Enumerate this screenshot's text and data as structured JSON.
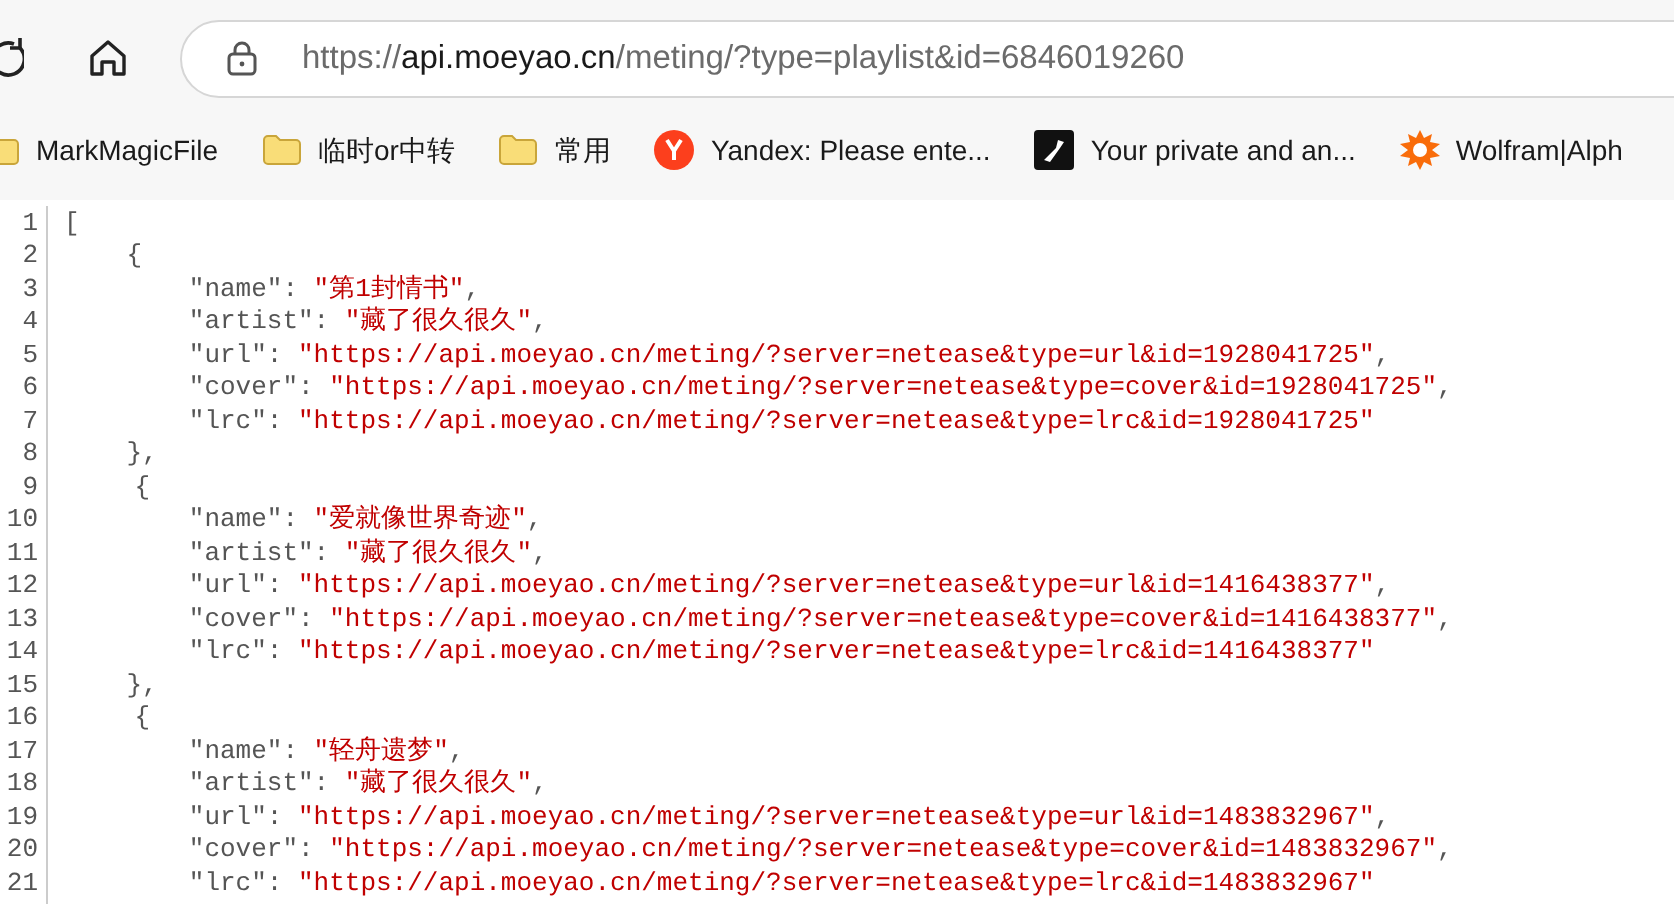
{
  "address_bar": {
    "scheme": "https://",
    "host": "api.moeyao.cn",
    "path": "/meting/?type=playlist&id=6846019260"
  },
  "bookmarks": [
    {
      "kind": "folder",
      "label": "MarkMagicFile"
    },
    {
      "kind": "folder",
      "label": "临时or中转"
    },
    {
      "kind": "folder",
      "label": "常用"
    },
    {
      "kind": "yandex",
      "label": "Yandex: Please ente..."
    },
    {
      "kind": "dark",
      "label": "Your private and an..."
    },
    {
      "kind": "wolfram",
      "label": "Wolfram|Alph"
    }
  ],
  "line_numbers": [
    "1",
    "2",
    "3",
    "4",
    "5",
    "6",
    "7",
    "8",
    "9",
    "10",
    "11",
    "12",
    "13",
    "14",
    "15",
    "16",
    "17",
    "18",
    "19",
    "20",
    "21"
  ],
  "document": {
    "open": "[",
    "objects": [
      {
        "open": "{",
        "close": "},",
        "props": [
          {
            "key": "\"name\":",
            "value": "\"第1封情书\"",
            "comma": ","
          },
          {
            "key": "\"artist\":",
            "value": "\"藏了很久很久\"",
            "comma": ","
          },
          {
            "key": "\"url\":",
            "value": "\"https://api.moeyao.cn/meting/?server=netease&type=url&id=1928041725\"",
            "comma": ","
          },
          {
            "key": "\"cover\":",
            "value": "\"https://api.moeyao.cn/meting/?server=netease&type=cover&id=1928041725\"",
            "comma": ","
          },
          {
            "key": "\"lrc\":",
            "value": "\"https://api.moeyao.cn/meting/?server=netease&type=lrc&id=1928041725\""
          }
        ]
      },
      {
        "open": "{",
        "close": "},",
        "props": [
          {
            "key": "\"name\":",
            "value": "\"爱就像世界奇迹\"",
            "comma": ","
          },
          {
            "key": "\"artist\":",
            "value": "\"藏了很久很久\"",
            "comma": ","
          },
          {
            "key": "\"url\":",
            "value": "\"https://api.moeyao.cn/meting/?server=netease&type=url&id=1416438377\"",
            "comma": ","
          },
          {
            "key": "\"cover\":",
            "value": "\"https://api.moeyao.cn/meting/?server=netease&type=cover&id=1416438377\"",
            "comma": ","
          },
          {
            "key": "\"lrc\":",
            "value": "\"https://api.moeyao.cn/meting/?server=netease&type=lrc&id=1416438377\""
          }
        ]
      },
      {
        "open": "{",
        "props": [
          {
            "key": "\"name\":",
            "value": "\"轻舟遗梦\"",
            "comma": ","
          },
          {
            "key": "\"artist\":",
            "value": "\"藏了很久很久\"",
            "comma": ","
          },
          {
            "key": "\"url\":",
            "value": "\"https://api.moeyao.cn/meting/?server=netease&type=url&id=1483832967\"",
            "comma": ","
          },
          {
            "key": "\"cover\":",
            "value": "\"https://api.moeyao.cn/meting/?server=netease&type=cover&id=1483832967\"",
            "comma": ","
          },
          {
            "key": "\"lrc\":",
            "value": "\"https://api.moeyao.cn/meting/?server=netease&type=lrc&id=1483832967\""
          }
        ]
      }
    ]
  }
}
